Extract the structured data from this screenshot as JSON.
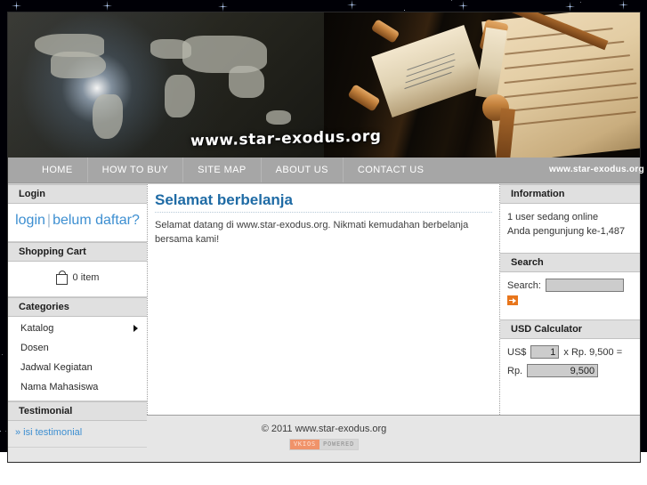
{
  "banner": {
    "url_text": "www.star-exodus.org"
  },
  "nav": {
    "items": [
      {
        "label": "HOME"
      },
      {
        "label": "HOW TO BUY"
      },
      {
        "label": "SITE MAP"
      },
      {
        "label": "ABOUT US"
      },
      {
        "label": "CONTACT US"
      }
    ],
    "right_url": "www.star-exodus.org"
  },
  "sidebar_left": {
    "login": {
      "title": "Login",
      "login_label": "login",
      "separator": "|",
      "register_label": "belum daftar?"
    },
    "cart": {
      "title": "Shopping Cart",
      "count_label": "0 item",
      "icon": "shopping-bag-icon"
    },
    "categories": {
      "title": "Categories",
      "items": [
        {
          "label": "Katalog",
          "has_submenu": true
        },
        {
          "label": "Dosen",
          "has_submenu": false
        },
        {
          "label": "Jadwal Kegiatan",
          "has_submenu": false
        },
        {
          "label": "Nama Mahasiswa",
          "has_submenu": false
        }
      ]
    },
    "testimonial": {
      "title": "Testimonial",
      "link_label": "» isi testimonial"
    }
  },
  "main": {
    "title": "Selamat berbelanja",
    "text": "Selamat datang di www.star-exodus.org. Nikmati kemudahan berbelanja bersama kami!"
  },
  "sidebar_right": {
    "information": {
      "title": "Information",
      "line1": "1 user sedang online",
      "line2": "Anda pengunjung ke-1,487"
    },
    "search": {
      "title": "Search",
      "label": "Search:",
      "value": "",
      "placeholder": "",
      "go_icon": "arrow-right-icon"
    },
    "usd_calculator": {
      "title": "USD Calculator",
      "currency_label": "US$",
      "amount_value": "1",
      "rate_text": "x Rp. 9,500 =",
      "result_label": "Rp.",
      "result_value": "9,500"
    }
  },
  "footer": {
    "copyright": "© 2011 www.star-exodus.org",
    "badge_left": "VKIOS",
    "badge_right": "POWERED"
  },
  "colors": {
    "accent_blue": "#3d8fd1",
    "heading_blue": "#1f6ba5",
    "nav_gray": "#a6a6a6",
    "panel_gray": "#e0e0e0",
    "orange": "#e8761c"
  }
}
